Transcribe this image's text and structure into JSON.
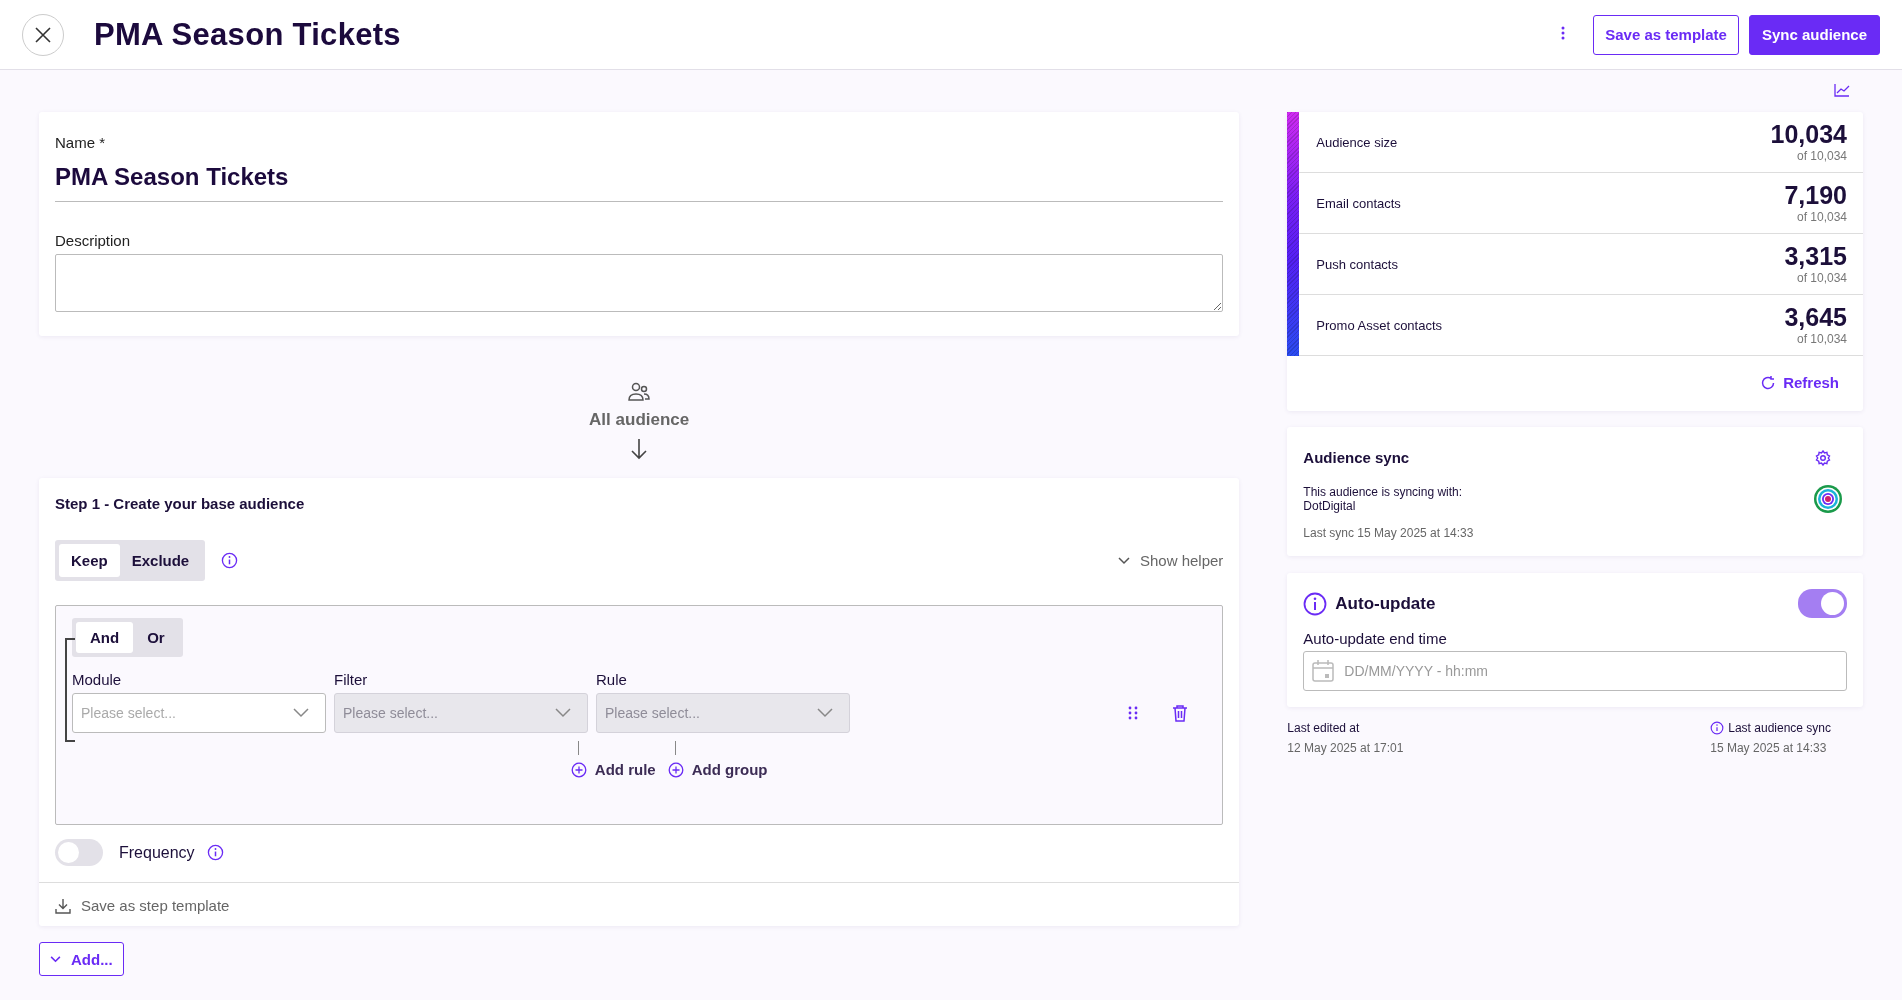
{
  "header": {
    "title": "PMA Season Tickets",
    "save_template": "Save as template",
    "sync": "Sync audience"
  },
  "name_field": {
    "label": "Name *",
    "value": "PMA Season Tickets"
  },
  "description_field": {
    "label": "Description"
  },
  "all_audience": "All audience",
  "step": {
    "title": "Step 1 - Create your base audience",
    "mode_tabs": [
      {
        "label": "Keep",
        "selected": true
      },
      {
        "label": "Exclude",
        "selected": false
      }
    ],
    "show_helper": "Show helper",
    "logic_tabs": [
      {
        "label": "And",
        "selected": true
      },
      {
        "label": "Or",
        "selected": false
      }
    ],
    "selects": [
      {
        "label": "Module",
        "placeholder": "Please select...",
        "disabled": false
      },
      {
        "label": "Filter",
        "placeholder": "Please select...",
        "disabled": true
      },
      {
        "label": "Rule",
        "placeholder": "Please select...",
        "disabled": true
      }
    ],
    "add_rule": "Add rule",
    "add_group": "Add group",
    "frequency": {
      "label": "Frequency",
      "on": false
    },
    "save_step_template": "Save as step template"
  },
  "add_button": "Add...",
  "stats": [
    {
      "label": "Audience size",
      "value": "10,034",
      "of": "of 10,034"
    },
    {
      "label": "Email contacts",
      "value": "7,190",
      "of": "of 10,034"
    },
    {
      "label": "Push contacts",
      "value": "3,315",
      "of": "of 10,034"
    },
    {
      "label": "Promo Asset contacts",
      "value": "3,645",
      "of": "of 10,034"
    }
  ],
  "refresh": "Refresh",
  "sync": {
    "title": "Audience sync",
    "text": "This audience is syncing with:",
    "target": "DotDigital",
    "last_sync": "Last sync 15 May 2025 at 14:33"
  },
  "auto_update": {
    "title": "Auto-update",
    "on": true,
    "field_label": "Auto-update end time",
    "placeholder": "DD/MM/YYYY - hh:mm"
  },
  "footer": {
    "edited_label": "Last edited at",
    "edited_value": "12 May 2025 at 17:01",
    "sync_label": "Last audience sync",
    "sync_value": "15 May 2025 at 14:33"
  }
}
